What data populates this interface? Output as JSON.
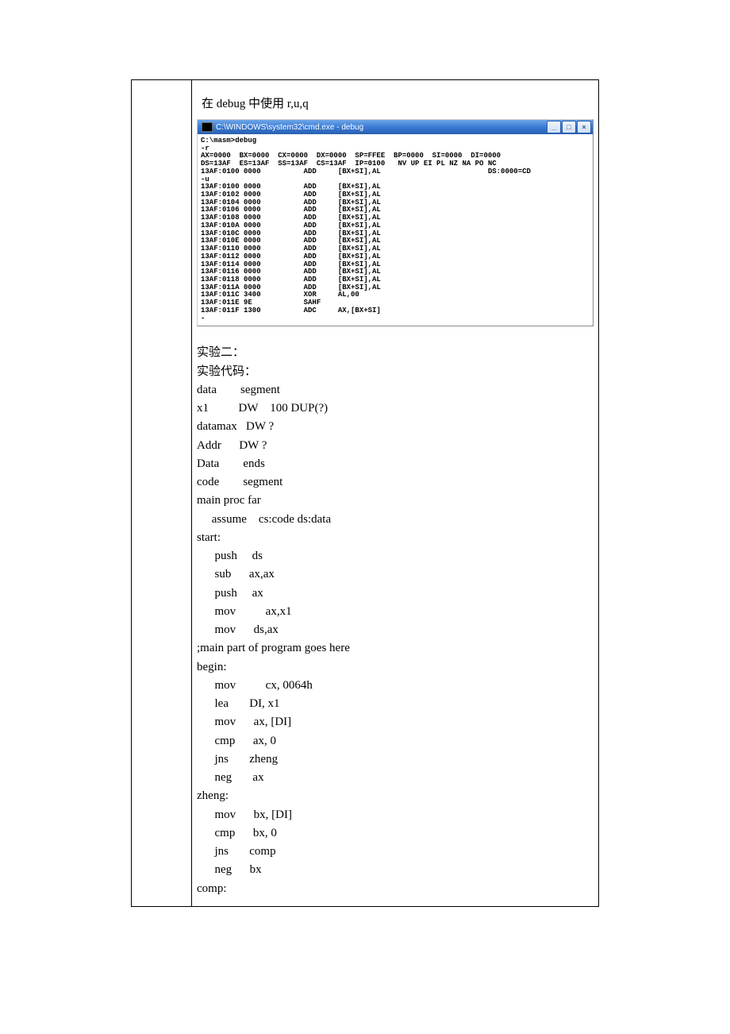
{
  "intro": "在 debug 中使用 r,u,q",
  "cmd": {
    "title": "C:\\WINDOWS\\system32\\cmd.exe - debug",
    "min_icon": "_",
    "max_icon": "□",
    "close_icon": "×",
    "body": "C:\\masm>debug\n-r\nAX=0000  BX=0000  CX=0000  DX=0000  SP=FFEE  BP=0000  SI=0000  DI=0000\nDS=13AF  ES=13AF  SS=13AF  CS=13AF  IP=0100   NV UP EI PL NZ NA PO NC\n13AF:0100 0000          ADD     [BX+SI],AL                         DS:0000=CD\n-u\n13AF:0100 0000          ADD     [BX+SI],AL\n13AF:0102 0000          ADD     [BX+SI],AL\n13AF:0104 0000          ADD     [BX+SI],AL\n13AF:0106 0000          ADD     [BX+SI],AL\n13AF:0108 0000          ADD     [BX+SI],AL\n13AF:010A 0000          ADD     [BX+SI],AL\n13AF:010C 0000          ADD     [BX+SI],AL\n13AF:010E 0000          ADD     [BX+SI],AL\n13AF:0110 0000          ADD     [BX+SI],AL\n13AF:0112 0000          ADD     [BX+SI],AL\n13AF:0114 0000          ADD     [BX+SI],AL\n13AF:0116 0000          ADD     [BX+SI],AL\n13AF:0118 0000          ADD     [BX+SI],AL\n13AF:011A 0000          ADD     [BX+SI],AL\n13AF:011C 3400          XOR     AL,00\n13AF:011E 9E            SAHF\n13AF:011F 1300          ADC     AX,[BX+SI]\n-"
  },
  "doc_body": "实验二：\n实验代码：\ndata        segment\nx1          DW    100 DUP(?)\ndatamax   DW ?\nAddr      DW ?\nData        ends\ncode        segment\nmain proc far\n     assume    cs:code ds:data\nstart:\n      push     ds\n      sub      ax,ax\n      push     ax\n      mov          ax,x1\n      mov      ds,ax\n;main part of program goes here\nbegin:\n      mov          cx, 0064h\n      lea       DI, x1\n      mov      ax, [DI]\n      cmp      ax, 0\n      jns       zheng\n      neg       ax\nzheng:\n      mov      bx, [DI]\n      cmp      bx, 0\n      jns       comp\n      neg      bx\ncomp:"
}
